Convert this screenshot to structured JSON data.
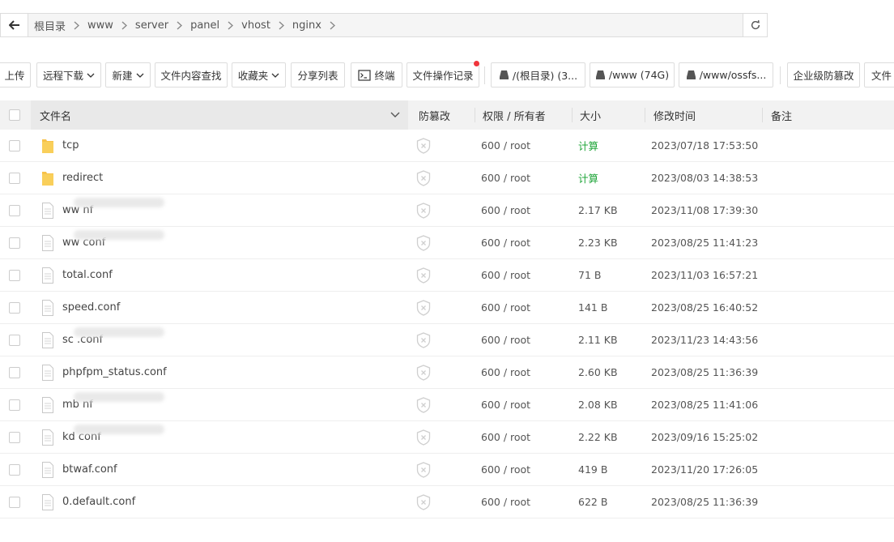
{
  "breadcrumb": [
    "根目录",
    "www",
    "server",
    "panel",
    "vhost",
    "nginx"
  ],
  "toolbar": {
    "upload": "上传",
    "remote_download": "远程下载",
    "new": "新建",
    "content_search": "文件内容查找",
    "favorites": "收藏夹",
    "share_list": "分享列表",
    "terminal": "终端",
    "operation_log": "文件操作记录",
    "disk_root": "/(根目录) (3...",
    "disk_www": "/www (74G)",
    "disk_ossfs": "/www/ossfs...",
    "enterprise_tamper": "企业级防篡改",
    "file_more": "文件"
  },
  "table": {
    "headers": {
      "name": "文件名",
      "tamper": "防篡改",
      "perm": "权限 / 所有者",
      "size": "大小",
      "mtime": "修改时间",
      "remark": "备注"
    },
    "rows": [
      {
        "type": "folder",
        "name": "tcp",
        "perm": "600 / root",
        "size": "计算",
        "mtime": "2023/07/18 17:53:50"
      },
      {
        "type": "folder",
        "name": "redirect",
        "perm": "600 / root",
        "size": "计算",
        "mtime": "2023/08/03 14:38:53"
      },
      {
        "type": "file",
        "name": "ww                    nf",
        "perm": "600 / root",
        "size": "2.17 KB",
        "mtime": "2023/11/08 17:39:30",
        "blurred": true
      },
      {
        "type": "file",
        "name": "ww                    conf",
        "perm": "600 / root",
        "size": "2.23 KB",
        "mtime": "2023/08/25 11:41:23",
        "blurred": true
      },
      {
        "type": "file",
        "name": "total.conf",
        "perm": "600 / root",
        "size": "71 B",
        "mtime": "2023/11/03 16:57:21"
      },
      {
        "type": "file",
        "name": "speed.conf",
        "perm": "600 / root",
        "size": "141 B",
        "mtime": "2023/08/25 16:40:52"
      },
      {
        "type": "file",
        "name": "sc                        .conf",
        "perm": "600 / root",
        "size": "2.11 KB",
        "mtime": "2023/11/23 14:43:56",
        "blurred": true
      },
      {
        "type": "file",
        "name": "phpfpm_status.conf",
        "perm": "600 / root",
        "size": "2.60 KB",
        "mtime": "2023/08/25 11:36:39"
      },
      {
        "type": "file",
        "name": "mb                  nf",
        "perm": "600 / root",
        "size": "2.08 KB",
        "mtime": "2023/08/25 11:41:06",
        "blurred": true
      },
      {
        "type": "file",
        "name": "kd                    conf",
        "perm": "600 / root",
        "size": "2.22 KB",
        "mtime": "2023/09/16 15:25:02",
        "blurred": true
      },
      {
        "type": "file",
        "name": "btwaf.conf",
        "perm": "600 / root",
        "size": "419 B",
        "mtime": "2023/11/20 17:26:05"
      },
      {
        "type": "file",
        "name": "0.default.conf",
        "perm": "600 / root",
        "size": "622 B",
        "mtime": "2023/08/25 11:36:39"
      }
    ]
  },
  "colors": {
    "accent_green": "#20a53a",
    "folder_yellow": "#f7c24a",
    "notice_red": "#f0353b"
  }
}
